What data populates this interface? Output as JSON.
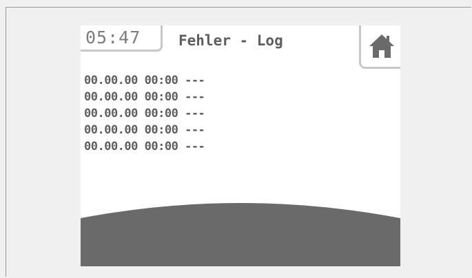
{
  "header": {
    "time": "05:47",
    "title": "Fehler - Log"
  },
  "home_button": {
    "icon": "home-icon"
  },
  "log": {
    "entries": [
      {
        "date": "00.00.00",
        "time": "00:00",
        "message": "---"
      },
      {
        "date": "00.00.00",
        "time": "00:00",
        "message": "---"
      },
      {
        "date": "00.00.00",
        "time": "00:00",
        "message": "---"
      },
      {
        "date": "00.00.00",
        "time": "00:00",
        "message": "---"
      },
      {
        "date": "00.00.00",
        "time": "00:00",
        "message": "---"
      }
    ]
  },
  "colors": {
    "background": "#f0f0f0",
    "screen": "#ffffff",
    "text": "#5e5e5e",
    "clock_text": "#7d7d7d",
    "border": "#c7c7c7",
    "footer_arc": "#6a6a6a"
  }
}
